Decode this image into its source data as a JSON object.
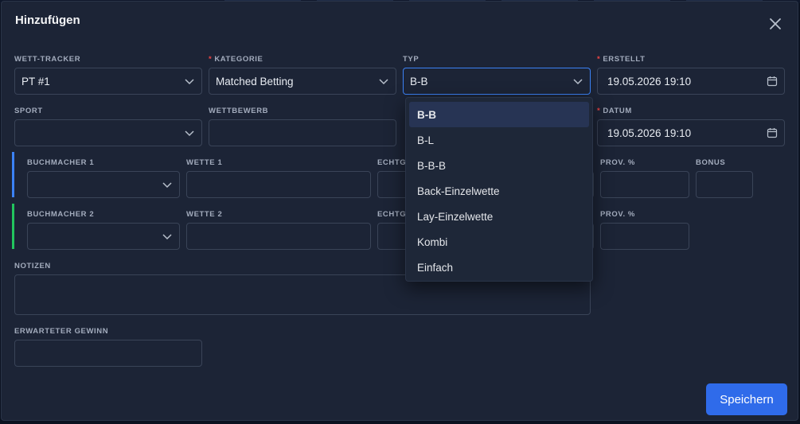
{
  "modal": {
    "title": "Hinzufügen",
    "save_label": "Speichern"
  },
  "fields": {
    "tracker": {
      "label": "WETT-TRACKER",
      "value": "PT #1"
    },
    "category": {
      "label": "KATEGORIE",
      "required": "*",
      "value": "Matched Betting"
    },
    "type": {
      "label": "TYP",
      "value": "B-B"
    },
    "created": {
      "label": "ERSTELLT",
      "required": "*",
      "value": "19.05.2026 19:10"
    },
    "sport": {
      "label": "SPORT",
      "value": ""
    },
    "competition": {
      "label": "WETTBEWERB",
      "value": ""
    },
    "date": {
      "label": "DATUM",
      "required": "*",
      "value": "19.05.2026 19:10"
    },
    "bookmaker1": {
      "label": "BUCHMACHER 1",
      "value": ""
    },
    "bet1": {
      "label": "WETTE 1",
      "value": ""
    },
    "odds1": {
      "label": "ECHTG",
      "value": ""
    },
    "commission1": {
      "label": "PROV. %",
      "value": ""
    },
    "bonus1": {
      "label": "BONUS",
      "value": ""
    },
    "bookmaker2": {
      "label": "BUCHMACHER 2",
      "value": ""
    },
    "bet2": {
      "label": "WETTE 2",
      "value": ""
    },
    "odds2": {
      "label": "ECHTG",
      "value": ""
    },
    "commission2": {
      "label": "PROV. %",
      "value": ""
    },
    "notes": {
      "label": "NOTIZEN",
      "value": ""
    },
    "expected_profit": {
      "label": "ERWARTETER GEWINN",
      "value": ""
    }
  },
  "type_dropdown": {
    "selected": "B-B",
    "options": [
      "B-B",
      "B-L",
      "B-B-B",
      "Back-Einzelwette",
      "Lay-Einzelwette",
      "Kombi",
      "Einfach"
    ]
  },
  "colors": {
    "accent_blue": "#3b82f6",
    "accent_green": "#22c55e",
    "required": "#ef4444",
    "primary_button": "#2f6bea"
  }
}
